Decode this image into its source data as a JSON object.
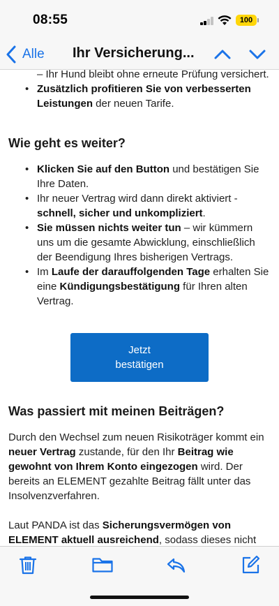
{
  "status_bar": {
    "time": "08:55",
    "battery": "100"
  },
  "nav": {
    "back_label": "Alle",
    "title": "Ihr Versicherung..."
  },
  "colors": {
    "accent": "#1a73e8",
    "button": "#0d6cc6",
    "battery": "#ffd60a"
  },
  "email": {
    "top_item": {
      "text": "– Ihr Hund bleibt ohne erneute Prüfung versichert."
    },
    "extra_item": {
      "bold": "Zusätzlich profitieren Sie von verbesserten Leistungen",
      "rest": " der neuen Tarife."
    },
    "section1": {
      "heading": "Wie geht es weiter?",
      "items": [
        {
          "bold1": "Klicken Sie auf den Button",
          "text1": " und bestätigen Sie Ihre Daten."
        },
        {
          "text1": "Ihr neuer Vertrag wird dann direkt aktiviert - ",
          "bold1": "schnell, sicher und unkompliziert",
          "text2": "."
        },
        {
          "bold1": "Sie müssen nichts weiter tun",
          "text1": " – wir kümmern uns um die gesamte Abwicklung, einschließlich der Beendigung Ihres bisherigen Vertrags."
        },
        {
          "text1": "Im ",
          "bold1": "Laufe der darauffolgenden Tage",
          "text2": " erhalten Sie eine ",
          "bold2": "Kündigungsbestätigung",
          "text3": " für Ihren alten Vertrag."
        }
      ]
    },
    "button": {
      "line1": "Jetzt",
      "line2": "bestätigen"
    },
    "section2": {
      "heading": "Was passiert mit meinen Beiträgen?",
      "para1": {
        "t1": "Durch den Wechsel zum neuen Risikoträger kommt ein ",
        "b1": "neuer Vertrag",
        "t2": " zustande, für den Ihr ",
        "b2": "Beitrag wie gewohnt von Ihrem Konto eingezogen",
        "t3": " wird. Der bereits an ELEMENT gezahlte Beitrag fällt unter das Insolvenzverfahren."
      },
      "para2": {
        "t1": "Laut PANDA ist das ",
        "b1": "Sicherungsvermögen von ELEMENT aktuell ausreichend",
        "t2": ", sodass dieses nicht"
      }
    }
  },
  "toolbar": {
    "icons": [
      "trash-icon",
      "folder-icon",
      "reply-icon",
      "compose-icon"
    ]
  }
}
